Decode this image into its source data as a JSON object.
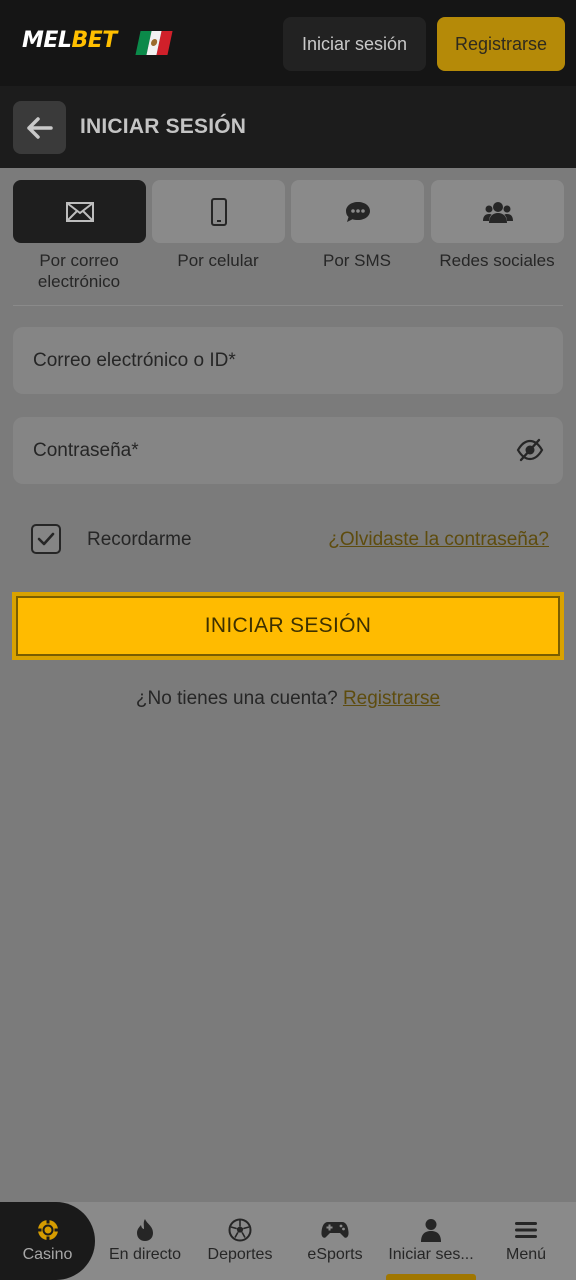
{
  "header": {
    "logo_mel": "MEL",
    "logo_bet": "BET",
    "login_label": "Iniciar sesión",
    "register_label": "Registrarse"
  },
  "titlebar": {
    "title": "INICIAR SESIÓN"
  },
  "methods": [
    {
      "label": "Por correo electrónico",
      "icon": "envelope-icon",
      "active": true
    },
    {
      "label": "Por celular",
      "icon": "phone-icon",
      "active": false
    },
    {
      "label": "Por SMS",
      "icon": "chat-bubble-icon",
      "active": false
    },
    {
      "label": "Redes sociales",
      "icon": "users-icon",
      "active": false
    }
  ],
  "form": {
    "email_placeholder": "Correo electrónico o ID*",
    "password_placeholder": "Contraseña*",
    "remember_label": "Recordarme",
    "remember_checked": true,
    "forgot_label": "¿Olvidaste la contraseña?",
    "submit_label": "INICIAR SESIÓN",
    "no_account_text": "¿No tienes una cuenta?",
    "register_link": "Registrarse"
  },
  "bottom_nav": [
    {
      "label": "Casino",
      "icon": "casino-chip-icon",
      "active": true
    },
    {
      "label": "En directo",
      "icon": "flame-icon",
      "active": false
    },
    {
      "label": "Deportes",
      "icon": "soccer-ball-icon",
      "active": false
    },
    {
      "label": "eSports",
      "icon": "gamepad-icon",
      "active": false
    },
    {
      "label": "Iniciar ses...",
      "icon": "user-icon",
      "active": false
    },
    {
      "label": "Menú",
      "icon": "hamburger-menu-icon",
      "active": false
    }
  ],
  "colors": {
    "accent": "#ffbb00",
    "header_bg": "#151515",
    "overlay_bg": "#7b7b7b"
  }
}
